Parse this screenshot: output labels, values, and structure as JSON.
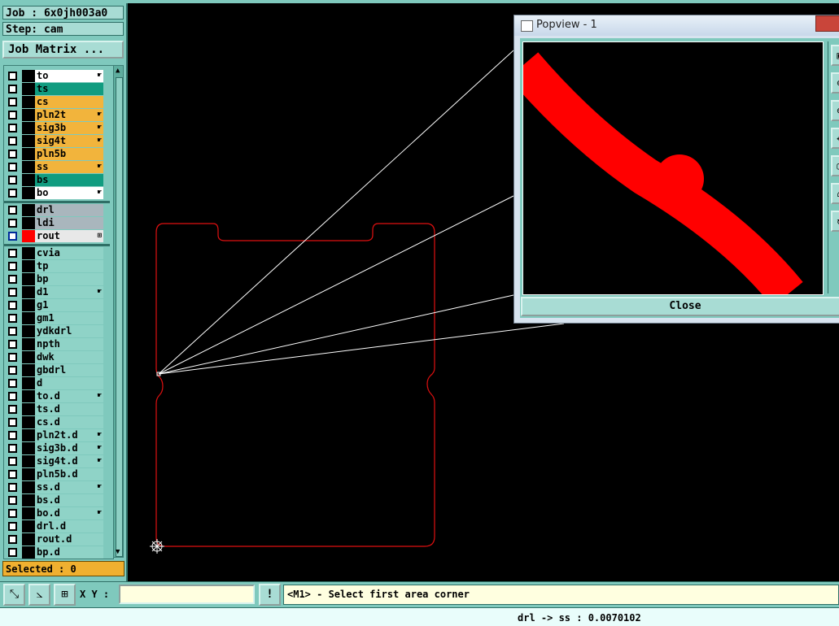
{
  "job": {
    "label": "Job : 6x0jh003a0",
    "step": "Step: cam",
    "matrix_button": "Job Matrix ..."
  },
  "layers": [
    {
      "name": "to",
      "color": "#ffffff",
      "mark": "☛"
    },
    {
      "name": "ts",
      "color": "#119c80",
      "mark": ""
    },
    {
      "name": "cs",
      "color": "#f2b43c",
      "mark": ""
    },
    {
      "name": "pln2t",
      "color": "#f2b43c",
      "mark": "☛"
    },
    {
      "name": "sig3b",
      "color": "#f2b43c",
      "mark": "☛"
    },
    {
      "name": "sig4t",
      "color": "#f2b43c",
      "mark": "☛"
    },
    {
      "name": "pln5b",
      "color": "#f2b43c",
      "mark": ""
    },
    {
      "name": "ss",
      "color": "#f2b43c",
      "mark": "☛"
    },
    {
      "name": "bs",
      "color": "#119c80",
      "mark": ""
    },
    {
      "name": "bo",
      "color": "#ffffff",
      "mark": "☛"
    },
    {
      "name": "drl",
      "color": "#a9b6bd",
      "mark": ""
    },
    {
      "name": "ldi",
      "color": "#a9b6bd",
      "mark": ""
    },
    {
      "name": "rout",
      "color": "#e8e8e8",
      "mark": "⊞"
    },
    {
      "name": "cvia",
      "color": "#8fd3c7",
      "mark": ""
    },
    {
      "name": "tp",
      "color": "#8fd3c7",
      "mark": ""
    },
    {
      "name": "bp",
      "color": "#8fd3c7",
      "mark": ""
    },
    {
      "name": "d1",
      "color": "#8fd3c7",
      "mark": "☛"
    },
    {
      "name": "g1",
      "color": "#8fd3c7",
      "mark": ""
    },
    {
      "name": "gm1",
      "color": "#8fd3c7",
      "mark": ""
    },
    {
      "name": "ydkdrl",
      "color": "#8fd3c7",
      "mark": ""
    },
    {
      "name": "npth",
      "color": "#8fd3c7",
      "mark": ""
    },
    {
      "name": "dwk",
      "color": "#8fd3c7",
      "mark": ""
    },
    {
      "name": "gbdrl",
      "color": "#8fd3c7",
      "mark": ""
    },
    {
      "name": "d",
      "color": "#8fd3c7",
      "mark": ""
    },
    {
      "name": "to.d",
      "color": "#8fd3c7",
      "mark": "☛"
    },
    {
      "name": "ts.d",
      "color": "#8fd3c7",
      "mark": ""
    },
    {
      "name": "cs.d",
      "color": "#8fd3c7",
      "mark": ""
    },
    {
      "name": "pln2t.d",
      "color": "#8fd3c7",
      "mark": "☛"
    },
    {
      "name": "sig3b.d",
      "color": "#8fd3c7",
      "mark": "☛"
    },
    {
      "name": "sig4t.d",
      "color": "#8fd3c7",
      "mark": "☛"
    },
    {
      "name": "pln5b.d",
      "color": "#8fd3c7",
      "mark": ""
    },
    {
      "name": "ss.d",
      "color": "#8fd3c7",
      "mark": "☛"
    },
    {
      "name": "bs.d",
      "color": "#8fd3c7",
      "mark": ""
    },
    {
      "name": "bo.d",
      "color": "#8fd3c7",
      "mark": "☛"
    },
    {
      "name": "drl.d",
      "color": "#8fd3c7",
      "mark": ""
    },
    {
      "name": "rout.d",
      "color": "#8fd3c7",
      "mark": ""
    },
    {
      "name": "bp.d",
      "color": "#8fd3c7",
      "mark": ""
    }
  ],
  "selected": "Selected : 0",
  "popview": {
    "title": "Popview - 1",
    "close_label": "Close"
  },
  "bottom": {
    "xy_label": "X Y :",
    "xy_value": "",
    "prompt": "<M1> - Select first area corner",
    "info_icon": "!"
  },
  "status": "drl -> ss : 0.0070102",
  "colors": {
    "panel": "#7fc9bd",
    "profile": "#e01010",
    "trace": "#ff0000"
  }
}
